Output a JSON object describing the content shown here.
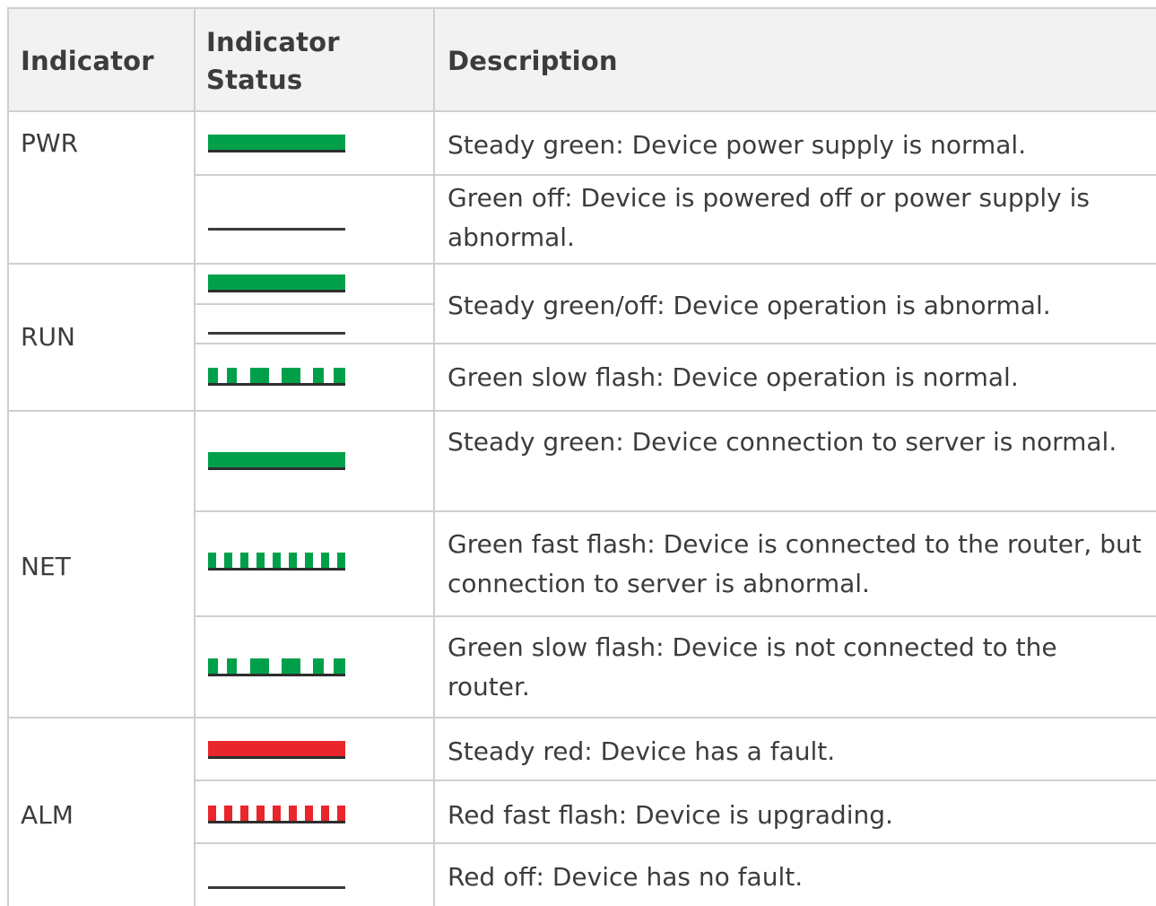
{
  "header": {
    "indicator": "Indicator",
    "status_line1": "Indicator",
    "status_line2": "Status",
    "description": "Description"
  },
  "indicators": {
    "pwr": "PWR",
    "run": "RUN",
    "net": "NET",
    "alm": "ALM"
  },
  "rows": [
    {
      "status": "steady-green",
      "description": "Steady green: Device power supply is normal."
    },
    {
      "status": "off",
      "description": "Green off: Device is powered off or power supply is abnormal."
    },
    {
      "status": "steady-green+off",
      "description": "Steady green/off: Device operation is abnormal."
    },
    {
      "status": "green-slow-flash",
      "description": "Green slow flash: Device operation is normal."
    },
    {
      "status": "steady-green",
      "description": "Steady green: Device connection to server is normal."
    },
    {
      "status": "green-fast-flash",
      "description": "Green fast flash: Device is connected to the router, but connection to server is abnormal."
    },
    {
      "status": "green-slow-flash",
      "description": "Green slow flash: Device is not connected to the router."
    },
    {
      "status": "steady-red",
      "description": "Steady red: Device has a fault."
    },
    {
      "status": "red-fast-flash",
      "description": "Red fast flash: Device is upgrading."
    },
    {
      "status": "off",
      "description": "Red off: Device has no fault."
    }
  ],
  "colors": {
    "green": "#00a04b",
    "red": "#e8262c",
    "off_line": "#3a3a3a",
    "grid": "#cfcfcf",
    "header_bg": "#f2f2f2",
    "text": "#3c3c3c"
  }
}
